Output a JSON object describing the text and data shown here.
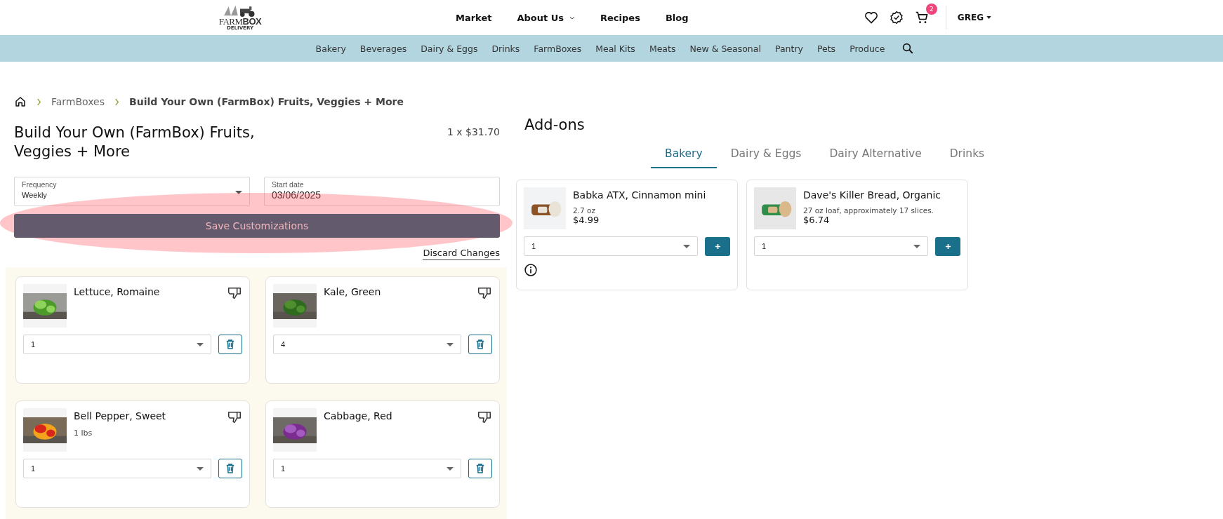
{
  "header": {
    "logo": {
      "word1": "FARM",
      "word2": "BOX",
      "tagline": "DELIVERY"
    },
    "main_nav": [
      {
        "label": "Market",
        "dropdown": false
      },
      {
        "label": "About Us",
        "dropdown": true
      },
      {
        "label": "Recipes",
        "dropdown": false
      },
      {
        "label": "Blog",
        "dropdown": false
      }
    ],
    "cart_count": "2",
    "user": "GREG"
  },
  "category_nav": [
    "Bakery",
    "Beverages",
    "Dairy & Eggs",
    "Drinks",
    "FarmBoxes",
    "Meal Kits",
    "Meats",
    "New & Seasonal",
    "Pantry",
    "Pets",
    "Produce"
  ],
  "breadcrumb": [
    {
      "label": "FarmBoxes",
      "current": false
    },
    {
      "label": "Build Your Own (FarmBox) Fruits, Veggies + More",
      "current": true
    }
  ],
  "product": {
    "title": "Build Your Own (FarmBox) Fruits, Veggies + More",
    "price": "1 x $31.70",
    "frequency": {
      "label": "Frequency",
      "value": "Weekly"
    },
    "start_date": {
      "label": "Start date",
      "value": "03/06/2025"
    },
    "save_button": "Save Customizations",
    "discard_link": "Discard Changes"
  },
  "box_items": [
    {
      "name": "Lettuce, Romaine",
      "quantity": "1"
    },
    {
      "name": "Kale, Green",
      "quantity": "4"
    },
    {
      "name": "Bell Pepper, Sweet",
      "note": "1 lbs",
      "quantity": "1"
    },
    {
      "name": "Cabbage, Red",
      "quantity": "1"
    }
  ],
  "addons": {
    "title": "Add-ons",
    "tabs": [
      {
        "label": "Bakery",
        "selected": true
      },
      {
        "label": "Dairy & Eggs",
        "selected": false
      },
      {
        "label": "Dairy Alternative",
        "selected": false
      },
      {
        "label": "Drinks",
        "selected": false
      }
    ],
    "products": [
      {
        "name": "Babka ATX, Cinnamon mini",
        "size": "2.7 oz",
        "price": "$4.99",
        "quantity": "1",
        "info": true
      },
      {
        "name": "Dave's Killer Bread, Organic",
        "size": "27 oz loaf, approximately 17 slices.",
        "price": "$6.74",
        "quantity": "1",
        "info": false
      }
    ]
  },
  "annotation": {
    "kind": "ellipse"
  }
}
